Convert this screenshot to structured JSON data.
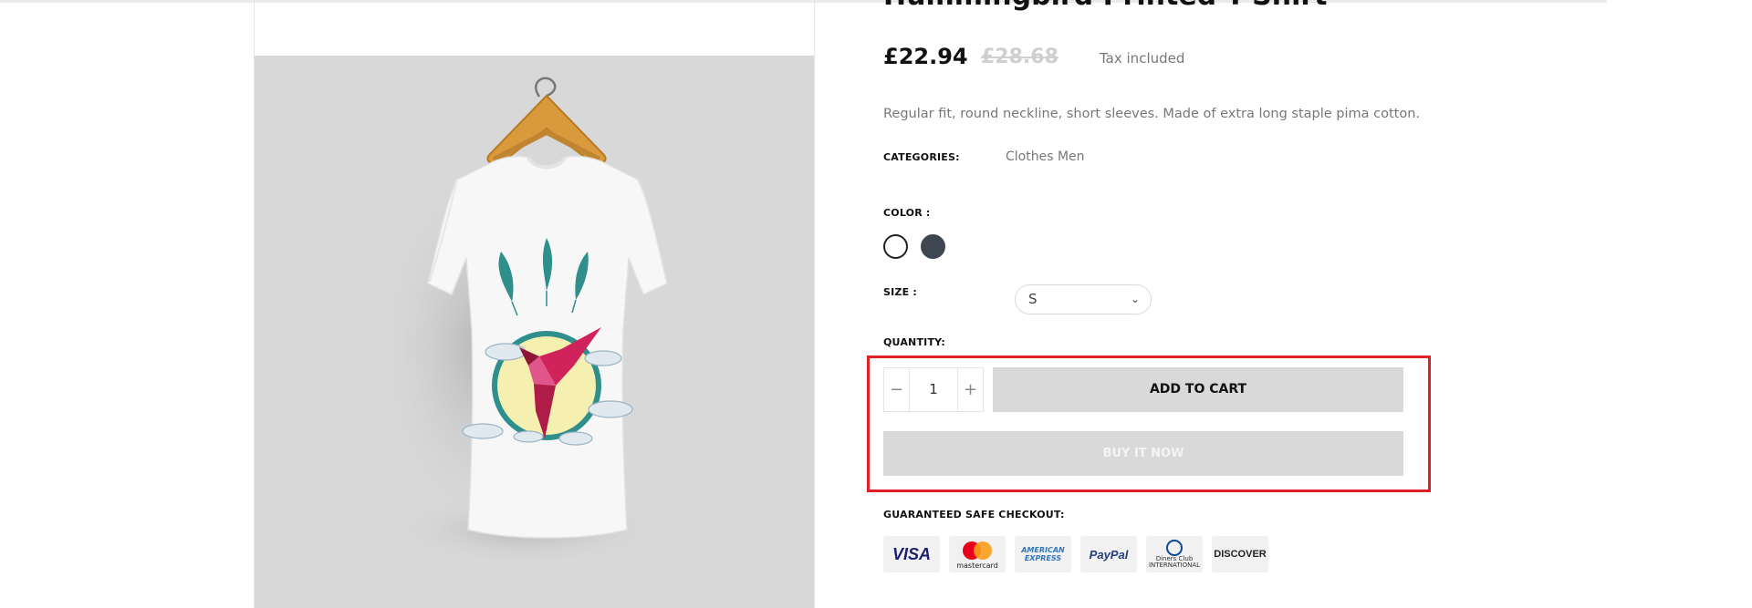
{
  "product": {
    "title": "Hummingbird Printed T-Shirt",
    "price": "£22.94",
    "old_price": "£28.68",
    "tax_note": "Tax included",
    "description": "Regular fit, round neckline, short sleeves. Made of extra long staple pima cotton."
  },
  "categories": {
    "label": "CATEGORIES:",
    "value": "Clothes Men"
  },
  "color": {
    "label": "COLOR :",
    "options": [
      "white",
      "dark-grey"
    ],
    "swatches": [
      "#ffffff",
      "#3e4650"
    ]
  },
  "size": {
    "label": "SIZE :",
    "selected": "S"
  },
  "quantity": {
    "label": "QUANTITY:",
    "value": "1",
    "minus": "−",
    "plus": "+"
  },
  "buttons": {
    "add_to_cart": "ADD TO CART",
    "buy_now": "BUY IT NOW"
  },
  "checkout": {
    "label": "GUARANTEED SAFE CHECKOUT:",
    "visa": "VISA",
    "mastercard": "mastercard",
    "amex": "AMERICAN EXPRESS",
    "paypal": "PayPal",
    "diners": "Diners Club INTERNATIONAL",
    "discover": "DISCOVER"
  },
  "colors": {
    "highlight": "#e11f26",
    "button_bg": "#d9d9d9"
  }
}
